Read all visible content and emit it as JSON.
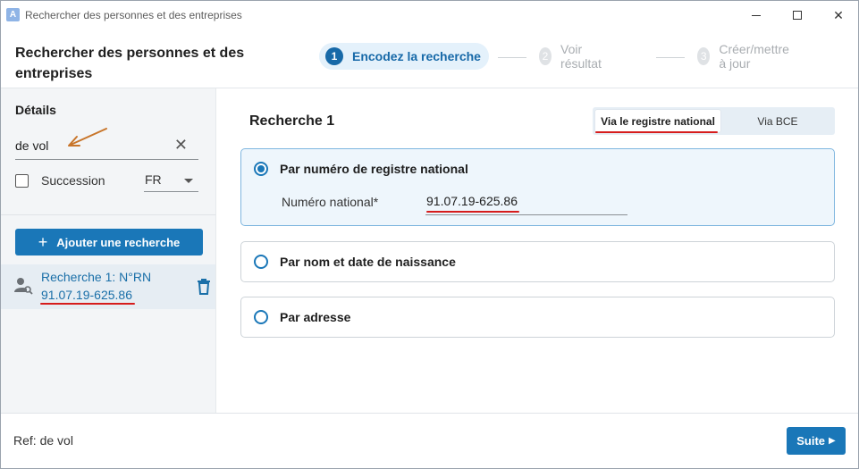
{
  "window": {
    "app_icon": "A",
    "title": "Rechercher des personnes et des entreprises"
  },
  "header": {
    "title": "Rechercher des personnes et des entreprises",
    "steps": [
      {
        "num": "1",
        "label": "Encodez la recherche",
        "state": "active"
      },
      {
        "num": "2",
        "label": "Voir résultat",
        "state": "inactive"
      },
      {
        "num": "3",
        "label": "Créer/mettre à jour",
        "state": "inactive"
      }
    ]
  },
  "sidebar": {
    "heading": "Détails",
    "name_value": "de vol",
    "clear_icon": "close-icon",
    "succession_label": "Succession",
    "succession_checked": false,
    "language_value": "FR",
    "add_button_label": "Ajouter une recherche",
    "searches": [
      {
        "title": "Recherche 1: N°RN",
        "value": "91.07.19-625.86"
      }
    ]
  },
  "main": {
    "title": "Recherche 1",
    "toggle": {
      "option1": "Via le registre national",
      "option2": "Via BCE",
      "selected": "option1"
    },
    "options": [
      {
        "label": "Par numéro de registre national",
        "checked": true
      },
      {
        "label": "Par nom et date de naissance",
        "checked": false
      },
      {
        "label": "Par adresse",
        "checked": false
      }
    ],
    "national_number_label": "Numéro national*",
    "national_number_value": "91.07.19-625.86"
  },
  "footer": {
    "ref_text": "Ref: de vol",
    "next_label": "Suite"
  },
  "colors": {
    "accent": "#1a77b8",
    "annotation_underline": "#d61c1c",
    "annotation_arrow": "#c8752a"
  }
}
